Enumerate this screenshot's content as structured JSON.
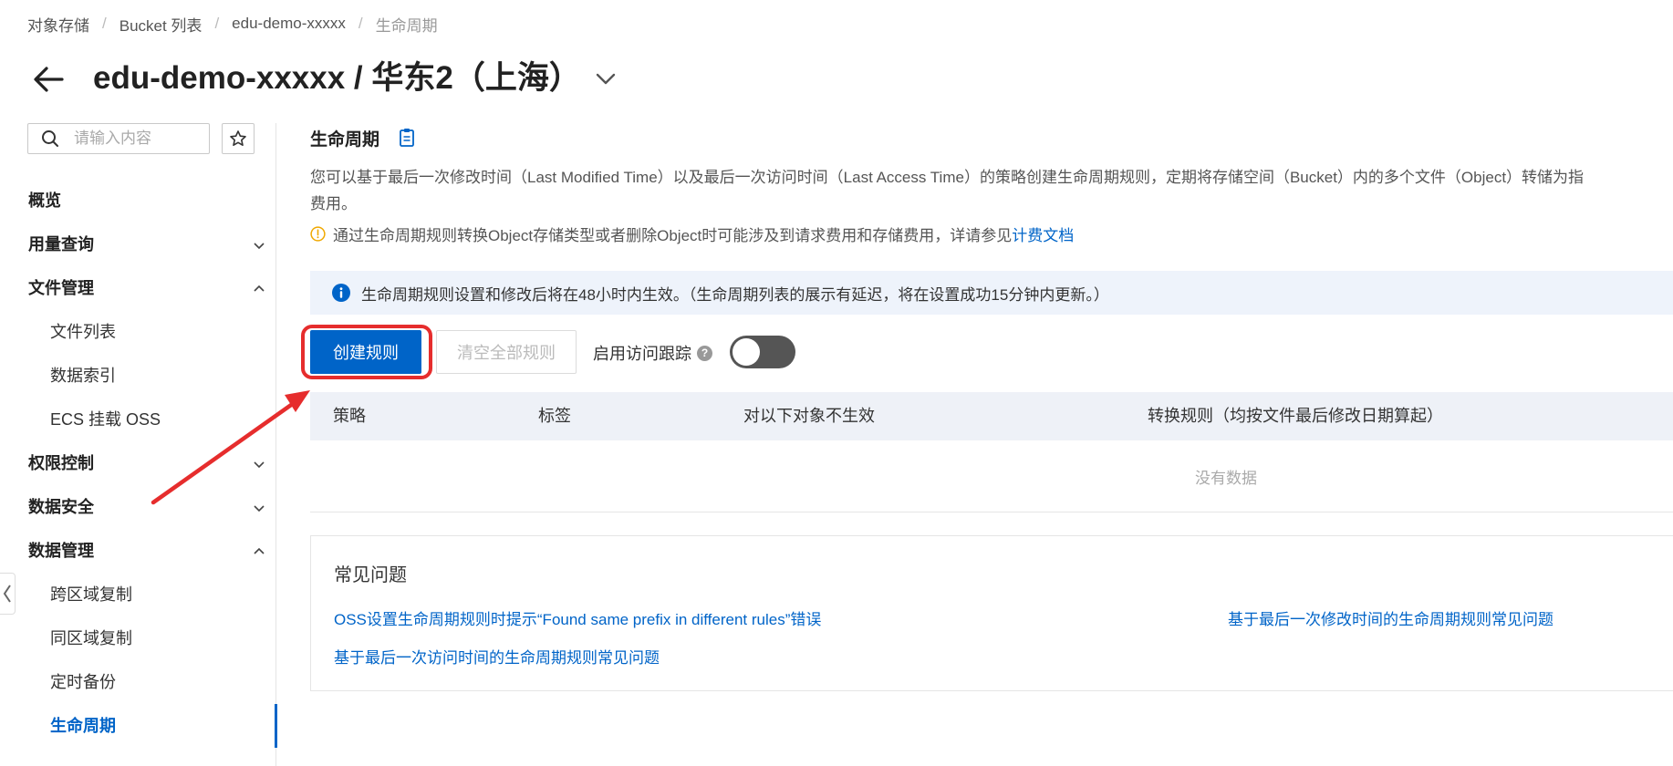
{
  "breadcrumb": [
    "对象存储",
    "Bucket 列表",
    "edu-demo-xxxxx",
    "生命周期"
  ],
  "header": {
    "title": "edu-demo-xxxxx / 华东2（上海）"
  },
  "sidebar": {
    "search_placeholder": "请输入内容",
    "items": [
      {
        "label": "概览",
        "type": "group"
      },
      {
        "label": "用量查询",
        "type": "group",
        "chevron": "down"
      },
      {
        "label": "文件管理",
        "type": "group",
        "chevron": "up"
      },
      {
        "label": "文件列表",
        "type": "sub"
      },
      {
        "label": "数据索引",
        "type": "sub"
      },
      {
        "label": "ECS 挂载 OSS",
        "type": "sub"
      },
      {
        "label": "权限控制",
        "type": "group",
        "chevron": "down"
      },
      {
        "label": "数据安全",
        "type": "group",
        "chevron": "down"
      },
      {
        "label": "数据管理",
        "type": "group",
        "chevron": "up"
      },
      {
        "label": "跨区域复制",
        "type": "sub"
      },
      {
        "label": "同区域复制",
        "type": "sub"
      },
      {
        "label": "定时备份",
        "type": "sub"
      },
      {
        "label": "生命周期",
        "type": "sub",
        "active": true
      }
    ]
  },
  "main": {
    "section_title": "生命周期",
    "description_line1": "您可以基于最后一次修改时间（Last Modified Time）以及最后一次访问时间（Last Access Time）的策略创建生命周期规则，定期将存储空间（Bucket）内的多个文件（Object）转储为指",
    "description_line2": "费用。",
    "warning_text": "通过生命周期规则转换Object存储类型或者删除Object时可能涉及到请求费用和存储费用，详请参见",
    "warning_link": "计费文档",
    "info_banner": "生命周期规则设置和修改后将在48小时内生效。（生命周期列表的展示有延迟，将在设置成功15分钟内更新。）",
    "create_button": "创建规则",
    "clear_button": "清空全部规则",
    "toggle_label": "启用访问跟踪",
    "toggle_on": false,
    "table": {
      "columns": [
        "策略",
        "标签",
        "对以下对象不生效",
        "转换规则（均按文件最后修改日期算起）"
      ],
      "empty_text": "没有数据"
    },
    "faq": {
      "title": "常见问题",
      "links": [
        "OSS设置生命周期规则时提示“Found same prefix in different rules”错误",
        "基于最后一次修改时间的生命周期规则常见问题",
        "基于最后一次访问时间的生命周期规则常见问题"
      ]
    }
  },
  "colors": {
    "accent": "#0064c8",
    "highlight": "#e62d2d",
    "banner_bg": "#eef3fb",
    "table_header_bg": "#eef1f7"
  }
}
